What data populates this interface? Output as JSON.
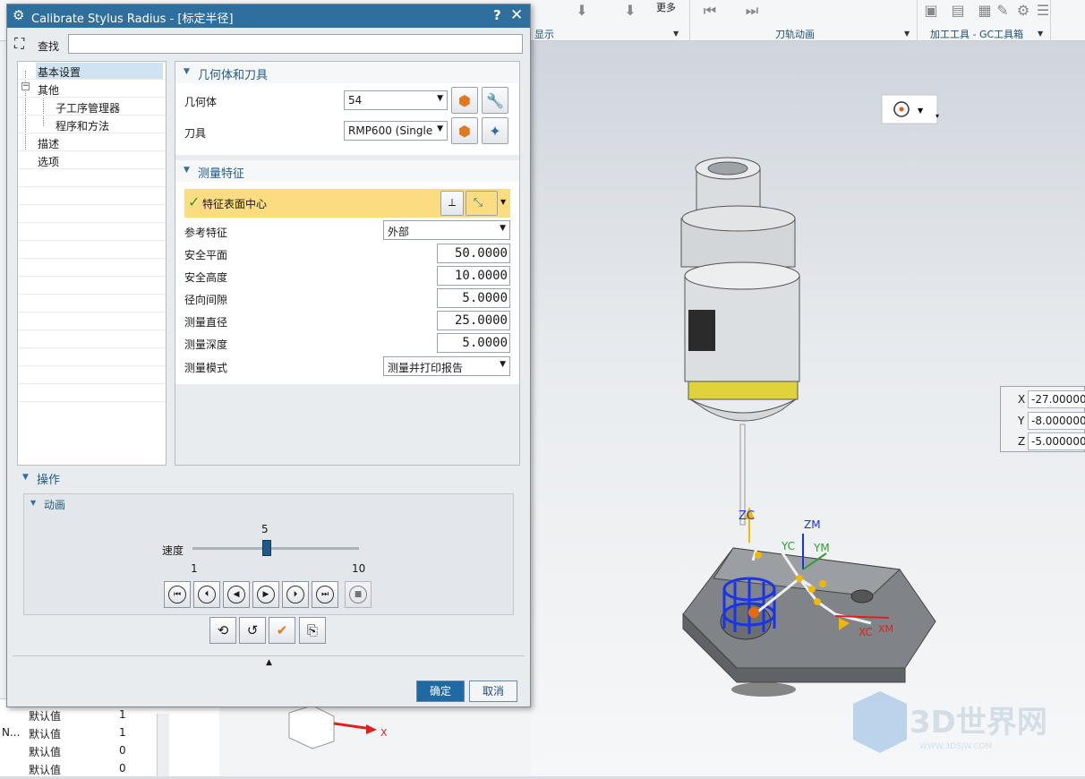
{
  "ribbon": {
    "group_labels": [
      "显示",
      "刀轨动画",
      "加工工具 - GC工具箱"
    ],
    "more_label": "更多"
  },
  "viewport": {
    "coord_rows": [
      {
        "axis": "X",
        "value": "-27.00000"
      },
      {
        "axis": "Y",
        "value": "-8.000000"
      },
      {
        "axis": "Z",
        "value": "-5.000000"
      }
    ],
    "axis_labels": {
      "zc": "ZC",
      "zm": "ZM",
      "yc": "YC",
      "ym": "YM",
      "xc": "XC",
      "xm": "XM"
    },
    "triad_x_label": "X",
    "watermark_main": "3D世界网",
    "watermark_sub": "WWW.3DSJW.COM"
  },
  "bottom_list": {
    "rows": [
      {
        "col1": "",
        "col2": "默认值",
        "col3": "1"
      },
      {
        "col1": "N...",
        "col2": "默认值",
        "col3": "1"
      },
      {
        "col1": "",
        "col2": "默认值",
        "col3": "0"
      },
      {
        "col1": "",
        "col2": "默认值",
        "col3": "0"
      }
    ]
  },
  "dialog": {
    "title": "Calibrate Stylus Radius - [标定半径]",
    "help": "?",
    "close": "✕",
    "find_label": "查找",
    "find_value": "",
    "tree": {
      "items": [
        {
          "label": "基本设置"
        },
        {
          "label": "其他"
        },
        {
          "label": "子工序管理器"
        },
        {
          "label": "程序和方法"
        },
        {
          "label": "描述"
        },
        {
          "label": "选项"
        }
      ]
    },
    "geometry_section": {
      "title": "几何体和刀具",
      "geometry_label": "几何体",
      "geometry_value": "54",
      "tool_label": "刀具",
      "tool_value": "RMP600 (Single"
    },
    "measure_section": {
      "title": "测量特征",
      "feature_label": "特征表面中心",
      "ref_feature_label": "参考特征",
      "ref_feature_value": "外部",
      "safe_plane_label": "安全平面",
      "safe_plane_value": "50.0000",
      "safe_height_label": "安全高度",
      "safe_height_value": "10.0000",
      "radial_clearance_label": "径向间隙",
      "radial_clearance_value": "5.0000",
      "measure_diameter_label": "测量直径",
      "measure_diameter_value": "25.0000",
      "measure_depth_label": "测量深度",
      "measure_depth_value": "5.0000",
      "measure_mode_label": "测量模式",
      "measure_mode_value": "测量并打印报告"
    },
    "operations": {
      "title": "操作",
      "animation_title": "动画",
      "speed_label": "速度",
      "speed_value": "5",
      "speed_min": "1",
      "speed_max": "10",
      "speed_fraction": 0.444
    },
    "ok_label": "确定",
    "cancel_label": "取消"
  },
  "colors": {
    "title_bar": "#2e6f9e",
    "feature_highlight": "#fbdc80",
    "primary_button": "#1f6aa5",
    "section_text": "#1f5a8a"
  }
}
